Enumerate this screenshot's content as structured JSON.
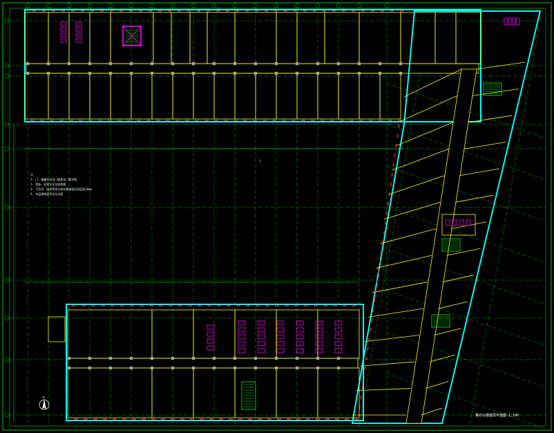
{
  "drawing": {
    "title_block": "某办公楼首层平面图 1:100",
    "north_label": "N",
    "notes_header": "注",
    "notes": [
      "1. 门、窗编号详见门窗表及门窗详图",
      "2. 墙体、柱定位详见结构图",
      "3. 卫生间、厨房等用水房间楼地面比同层低20mm",
      "4. 本层建筑面积详见总图"
    ],
    "courtyard_label": "L",
    "colors": {
      "background": "#000000",
      "grid_axis": "#00ff00",
      "wall": "#ffff00",
      "window": "#00ffff",
      "door": "#ff00ff",
      "column": "#00ffff",
      "corridor_fill": "#000000",
      "dimension": "#00ff00",
      "accent_red": "#ff2020",
      "accent_white": "#ffffff"
    }
  }
}
